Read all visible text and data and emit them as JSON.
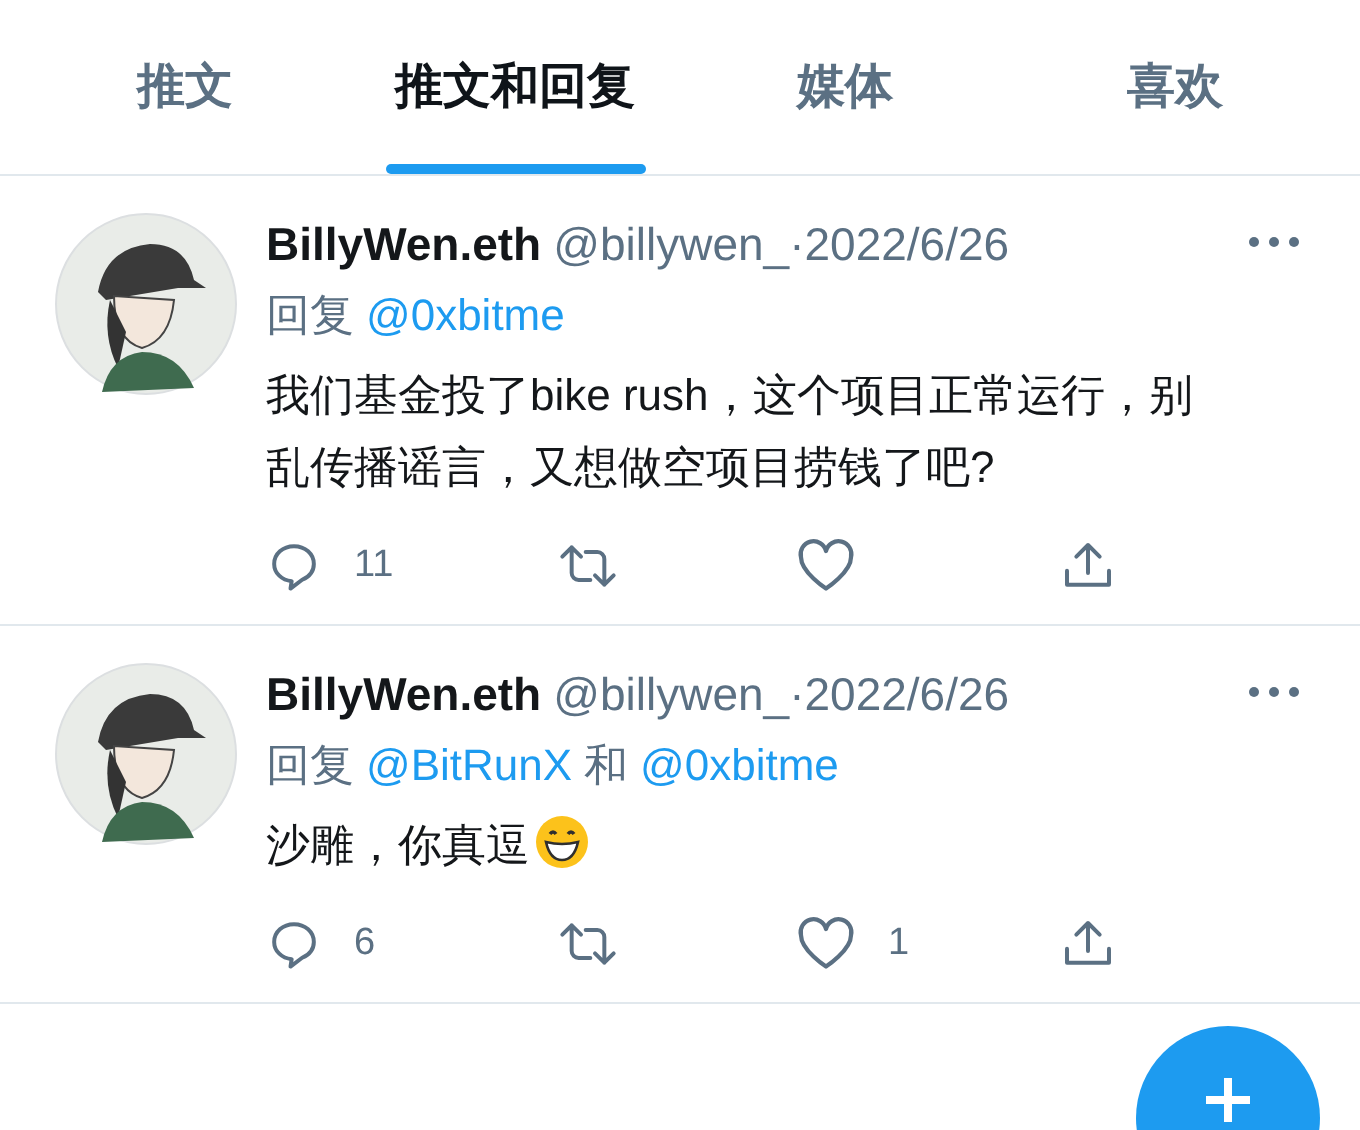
{
  "tabs": [
    {
      "label": "推文",
      "selected": false
    },
    {
      "label": "推文和回复",
      "selected": true
    },
    {
      "label": "媒体",
      "selected": false
    },
    {
      "label": "喜欢",
      "selected": false
    }
  ],
  "tweets": [
    {
      "name": "BillyWen.eth",
      "handle": "@billywen_",
      "separator": "·",
      "date": "2022/6/26",
      "reply": [
        {
          "kind": "text",
          "text": "回复"
        },
        {
          "kind": "mention",
          "text": "@0xbitme"
        }
      ],
      "body": "我们基金投了bike rush，这个项目正常运行，别乱传播谣言，又想做空项目捞钱了吧?",
      "emoji": false,
      "replies": "11"
    },
    {
      "name": "BillyWen.eth",
      "handle": "@billywen_",
      "separator": "·",
      "date": "2022/6/26",
      "reply": [
        {
          "kind": "text",
          "text": "回复"
        },
        {
          "kind": "mention",
          "text": "@BitRunX"
        },
        {
          "kind": "text",
          "text": "和"
        },
        {
          "kind": "mention",
          "text": "@0xbitme"
        }
      ],
      "body": "沙雕，你真逗",
      "emoji": true,
      "replies": "6",
      "likes": "1"
    }
  ]
}
